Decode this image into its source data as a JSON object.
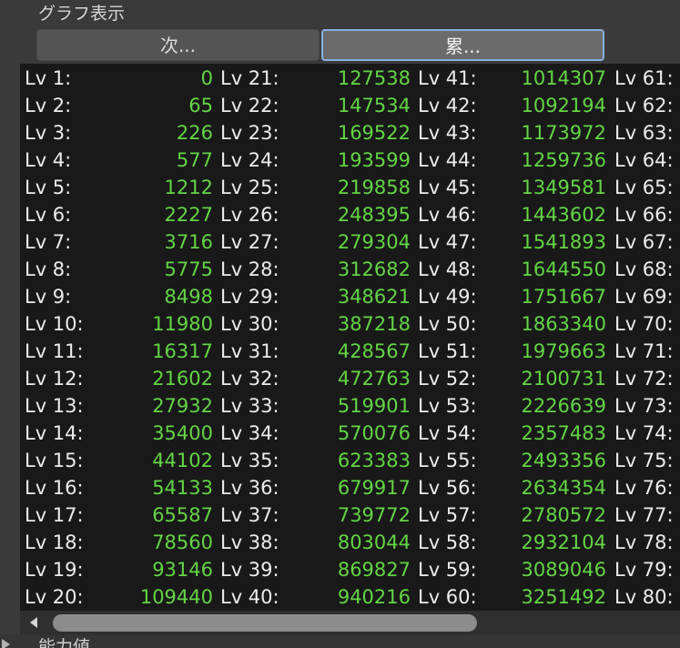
{
  "section_title": "グラフ表示",
  "tabs": [
    {
      "label": "次...",
      "selected": false
    },
    {
      "label": "累...",
      "selected": true
    }
  ],
  "next_section_label": "能力値",
  "colors": {
    "value_text": "#63d545",
    "label_text": "#ececec",
    "panel_bg": "#191919",
    "selected_tab_border": "#86aede"
  },
  "icons": {
    "scroll_left": "arrow-left-icon",
    "expand": "triangle-right-icon"
  },
  "columns": [
    {
      "rows": [
        {
          "label": "Lv 1:",
          "value": "0"
        },
        {
          "label": "Lv 2:",
          "value": "65"
        },
        {
          "label": "Lv 3:",
          "value": "226"
        },
        {
          "label": "Lv 4:",
          "value": "577"
        },
        {
          "label": "Lv 5:",
          "value": "1212"
        },
        {
          "label": "Lv 6:",
          "value": "2227"
        },
        {
          "label": "Lv 7:",
          "value": "3716"
        },
        {
          "label": "Lv 8:",
          "value": "5775"
        },
        {
          "label": "Lv 9:",
          "value": "8498"
        },
        {
          "label": "Lv 10:",
          "value": "11980"
        },
        {
          "label": "Lv 11:",
          "value": "16317"
        },
        {
          "label": "Lv 12:",
          "value": "21602"
        },
        {
          "label": "Lv 13:",
          "value": "27932"
        },
        {
          "label": "Lv 14:",
          "value": "35400"
        },
        {
          "label": "Lv 15:",
          "value": "44102"
        },
        {
          "label": "Lv 16:",
          "value": "54133"
        },
        {
          "label": "Lv 17:",
          "value": "65587"
        },
        {
          "label": "Lv 18:",
          "value": "78560"
        },
        {
          "label": "Lv 19:",
          "value": "93146"
        },
        {
          "label": "Lv 20:",
          "value": "109440"
        }
      ]
    },
    {
      "rows": [
        {
          "label": "Lv 21:",
          "value": "127538"
        },
        {
          "label": "Lv 22:",
          "value": "147534"
        },
        {
          "label": "Lv 23:",
          "value": "169522"
        },
        {
          "label": "Lv 24:",
          "value": "193599"
        },
        {
          "label": "Lv 25:",
          "value": "219858"
        },
        {
          "label": "Lv 26:",
          "value": "248395"
        },
        {
          "label": "Lv 27:",
          "value": "279304"
        },
        {
          "label": "Lv 28:",
          "value": "312682"
        },
        {
          "label": "Lv 29:",
          "value": "348621"
        },
        {
          "label": "Lv 30:",
          "value": "387218"
        },
        {
          "label": "Lv 31:",
          "value": "428567"
        },
        {
          "label": "Lv 32:",
          "value": "472763"
        },
        {
          "label": "Lv 33:",
          "value": "519901"
        },
        {
          "label": "Lv 34:",
          "value": "570076"
        },
        {
          "label": "Lv 35:",
          "value": "623383"
        },
        {
          "label": "Lv 36:",
          "value": "679917"
        },
        {
          "label": "Lv 37:",
          "value": "739772"
        },
        {
          "label": "Lv 38:",
          "value": "803044"
        },
        {
          "label": "Lv 39:",
          "value": "869827"
        },
        {
          "label": "Lv 40:",
          "value": "940216"
        }
      ]
    },
    {
      "rows": [
        {
          "label": "Lv 41:",
          "value": "1014307"
        },
        {
          "label": "Lv 42:",
          "value": "1092194"
        },
        {
          "label": "Lv 43:",
          "value": "1173972"
        },
        {
          "label": "Lv 44:",
          "value": "1259736"
        },
        {
          "label": "Lv 45:",
          "value": "1349581"
        },
        {
          "label": "Lv 46:",
          "value": "1443602"
        },
        {
          "label": "Lv 47:",
          "value": "1541893"
        },
        {
          "label": "Lv 48:",
          "value": "1644550"
        },
        {
          "label": "Lv 49:",
          "value": "1751667"
        },
        {
          "label": "Lv 50:",
          "value": "1863340"
        },
        {
          "label": "Lv 51:",
          "value": "1979663"
        },
        {
          "label": "Lv 52:",
          "value": "2100731"
        },
        {
          "label": "Lv 53:",
          "value": "2226639"
        },
        {
          "label": "Lv 54:",
          "value": "2357483"
        },
        {
          "label": "Lv 55:",
          "value": "2493356"
        },
        {
          "label": "Lv 56:",
          "value": "2634354"
        },
        {
          "label": "Lv 57:",
          "value": "2780572"
        },
        {
          "label": "Lv 58:",
          "value": "2932104"
        },
        {
          "label": "Lv 59:",
          "value": "3089046"
        },
        {
          "label": "Lv 60:",
          "value": "3251492"
        }
      ]
    },
    {
      "rows": [
        {
          "label": "Lv 61:"
        },
        {
          "label": "Lv 62:"
        },
        {
          "label": "Lv 63:"
        },
        {
          "label": "Lv 64:"
        },
        {
          "label": "Lv 65:"
        },
        {
          "label": "Lv 66:"
        },
        {
          "label": "Lv 67:"
        },
        {
          "label": "Lv 68:"
        },
        {
          "label": "Lv 69:"
        },
        {
          "label": "Lv 70:"
        },
        {
          "label": "Lv 71:"
        },
        {
          "label": "Lv 72:"
        },
        {
          "label": "Lv 73:"
        },
        {
          "label": "Lv 74:"
        },
        {
          "label": "Lv 75:"
        },
        {
          "label": "Lv 76:"
        },
        {
          "label": "Lv 77:"
        },
        {
          "label": "Lv 78:"
        },
        {
          "label": "Lv 79:"
        },
        {
          "label": "Lv 80:"
        }
      ]
    }
  ]
}
